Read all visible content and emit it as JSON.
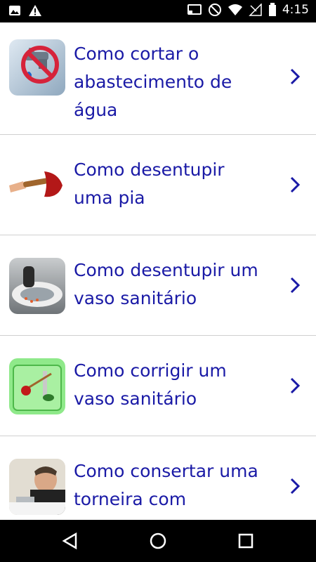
{
  "status_bar": {
    "time": "4:15"
  },
  "items": [
    {
      "title": "Como cortar o abastecimento de água",
      "icon": "faucet-no-water-icon"
    },
    {
      "title": "Como desentupir uma pia",
      "icon": "plunger-icon"
    },
    {
      "title": "Como desentupir um vaso sanitário",
      "icon": "toilet-glove-icon"
    },
    {
      "title": "Como corrigir um vaso sanitário",
      "icon": "toilet-tank-icon"
    },
    {
      "title": "Como consertar uma torneira com",
      "icon": "man-fixing-faucet-icon"
    }
  ],
  "colors": {
    "title": "#1a1aa6",
    "chevron": "#1a1aa6",
    "divider": "#d0d0d0"
  }
}
